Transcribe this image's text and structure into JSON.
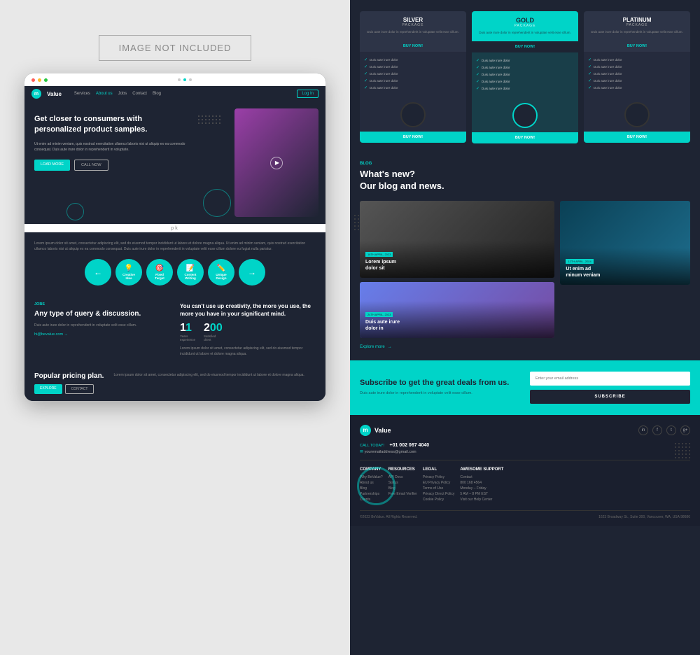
{
  "left": {
    "image_not_included": "IMAGE NOT INCLUDED",
    "nav": {
      "brand": "Value",
      "links": [
        "Services",
        "About us",
        "Jobs",
        "Contact",
        "Blog"
      ],
      "active": "About us",
      "login": "Log In"
    },
    "hero": {
      "title": "Get closer to consumers with personalized product samples.",
      "subtitle": "Ut enim ad minim veniam, quis nostrud exercitation ullamco laboris nisi ut aliquip ex ea commodo consequat. Duis aute irure dolor in reprehenderit in voluptate.",
      "btn_load": "LOAD MORE",
      "btn_call": "CALL NOW"
    },
    "features": {
      "text": "Lorem ipsum dolor sit amet, consectetur adipiscing elit, sed do eiusmod tempor incididunt ut labore et dolore magna aliqua. Ut enim ad minim veniam, quis nostrud exercitation ullamco laboris nisi ut aliquip ex ea commodo consequat. Duis aute irure dolor in reprehenderit in voluptate velit esse cillum dolore eu fugiat nulla pariatur.",
      "items": [
        {
          "label": "Creative\nIdea",
          "icon": "💡"
        },
        {
          "label": "Fixed\nTarget",
          "icon": "🎯"
        },
        {
          "label": "Content\nWriting",
          "icon": "📝"
        },
        {
          "label": "Unique\nDesign",
          "icon": "✏️"
        }
      ]
    },
    "jobs": {
      "tag": "JOBS",
      "title": "Any type of query & discussion.",
      "desc": "Duis aute irure dolor in reprehenderit in voluptate velit esse cillum.",
      "link": "hi@bevalue.com",
      "quote": "You can't use up creativity, the more you use, the more you have in your significant mind.",
      "stats": [
        {
          "num": "11",
          "label": "Years\nexperience"
        },
        {
          "num": "200",
          "label": "Satisfied\nclient"
        }
      ],
      "extra": "Lorem ipsum dolor sit amet, consectetur adipiscing elit, sed do eiusmod tempor incididunt ut labore et dolore magna aliqua."
    },
    "pricing": {
      "title": "Popular pricing plan.",
      "desc": "Lorem ipsum dolor sit amet, consectetur adipiscing elit, sed do eiusmod tempor incididunt ut labore et dolore magna aliqua.",
      "btn_explore": "EXPLORE",
      "btn_contact": "CONTACT"
    }
  },
  "right": {
    "packages": {
      "label": "PACKAGE",
      "items": [
        {
          "type": "silver",
          "name": "SILVER",
          "label": "PACKAGE",
          "desc": "Duis aute irure dolor in reprehenderit in voluptate velit esse cillum.",
          "buy": "BUY NOW!",
          "features": [
            "Duis aute irure dolor",
            "Duis aute irure dolor",
            "Duis aute irure dolor",
            "Duis aute irure dolor",
            "Duis aute irure dolor"
          ]
        },
        {
          "type": "gold",
          "name": "GOLD",
          "label": "PACKAGE",
          "desc": "Duis aute irure dolor in reprehenderit in voluptate velit esse cillum.",
          "buy": "BUY NOW!",
          "features": [
            "Duis aute irure dolor",
            "Duis aute irure dolor",
            "Duis aute irure dolor",
            "Duis aute irure dolor",
            "Duis aute irure dolor"
          ]
        },
        {
          "type": "platinum",
          "name": "PLATINUM",
          "label": "PACKAGE",
          "desc": "Duis aute irure dolor in reprehenderit in voluptate velit esse cillum.",
          "buy": "BUY NOW!",
          "features": [
            "Duis aute irure dolor",
            "Duis aute irure dolor",
            "Duis aute irure dolor",
            "Duis aute irure dolor",
            "Duis aute irure dolor"
          ]
        }
      ]
    },
    "blog": {
      "tag": "BLOG",
      "title": "What's new?\nOur blog and news.",
      "posts": [
        {
          "date": "16TH APRIL, 2023",
          "title": "Lorem ipsum dolor sit"
        },
        {
          "date": "24TH APRIL, 2023",
          "title": "Duis aute irure dolor in"
        },
        {
          "date": "12TH APRIL, 2024",
          "title": "Ut enim ad minum veniam"
        }
      ],
      "explore": "Explore more"
    },
    "subscribe": {
      "title": "Subscribe to get the great deals from us.",
      "desc": "Duis aute irure dolor in reprehenderit in voluptate velit esse cillum.",
      "placeholder": "Enter your email address",
      "btn": "SUBSCRIBE"
    },
    "footer": {
      "brand": "Value",
      "call_label": "CALL TODAY!",
      "phone": "+01 002 067 4040",
      "email": "youremailaddress@gmail.com",
      "social": [
        "in",
        "f",
        "t",
        "g+"
      ],
      "cols": [
        {
          "title": "COMPANY",
          "items": [
            "Why BeValue?",
            "About us",
            "Blog",
            "Partnerships",
            "Clients"
          ]
        },
        {
          "title": "RESOURCES",
          "items": [
            "API Docs",
            "Status",
            "Blog",
            "Free Email Verifier"
          ]
        },
        {
          "title": "LEGAL",
          "items": [
            "Privacy Policy",
            "EU Privacy Policy",
            "Terms of Use",
            "Privacy Direct Policy",
            "Cookie Policy"
          ]
        },
        {
          "title": "AWESOME SUPPORT",
          "items": [
            "Contact",
            "800 168 4564",
            "Monday – Friday",
            "5 AM – 8 PM EST",
            "Visit our Help Center"
          ]
        }
      ],
      "copyright": "©2023 BeValue. All Rights Reserved.",
      "address": "1623 Broadway St., Suite 300, Vancouver, WA, USA 98686"
    }
  }
}
